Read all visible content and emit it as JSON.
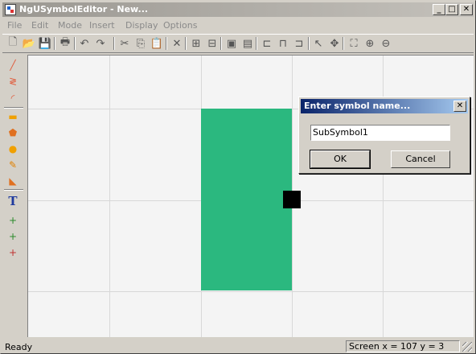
{
  "window": {
    "title": "NgUSymbolEditor - New...",
    "controls": {
      "minimize": "_",
      "maximize": "□",
      "close": "✕"
    }
  },
  "menu": [
    "File",
    "Edit",
    "Mode",
    "Insert",
    "Display",
    "Options"
  ],
  "toolbar": [
    {
      "name": "new-icon",
      "glyph": "🗋"
    },
    {
      "name": "open-icon",
      "glyph": "📂"
    },
    {
      "name": "save-icon",
      "glyph": "💾"
    },
    {
      "name": "print-icon",
      "glyph": "🖶"
    },
    {
      "name": "undo-icon",
      "glyph": "↶"
    },
    {
      "name": "redo-icon",
      "glyph": "↷"
    },
    {
      "name": "cut-icon",
      "glyph": "✂"
    },
    {
      "name": "copy-icon",
      "glyph": "⎘"
    },
    {
      "name": "paste-icon",
      "glyph": "📋"
    },
    {
      "name": "delete-icon",
      "glyph": "✕"
    },
    {
      "name": "group-icon",
      "glyph": "⊞"
    },
    {
      "name": "ungroup-icon",
      "glyph": "⊟"
    },
    {
      "name": "bring-front-icon",
      "glyph": "▣"
    },
    {
      "name": "send-back-icon",
      "glyph": "▤"
    },
    {
      "name": "align-left-icon",
      "glyph": "⊏"
    },
    {
      "name": "align-center-icon",
      "glyph": "⊓"
    },
    {
      "name": "align-right-icon",
      "glyph": "⊐"
    },
    {
      "name": "select-pointer-icon",
      "glyph": "↖"
    },
    {
      "name": "move-pointer-icon",
      "glyph": "✥"
    },
    {
      "name": "zoom-fit-icon",
      "glyph": "⛶"
    },
    {
      "name": "zoom-in-icon",
      "glyph": "⊕"
    },
    {
      "name": "zoom-out-icon",
      "glyph": "⊖"
    }
  ],
  "tools": [
    {
      "name": "line-tool-icon",
      "glyph": "╱",
      "color": "#e05a3a"
    },
    {
      "name": "polyline-tool-icon",
      "glyph": "≷",
      "color": "#e05a3a"
    },
    {
      "name": "arc-tool-icon",
      "glyph": "◜",
      "color": "#e05a3a"
    },
    {
      "name": "rectangle-tool-icon",
      "glyph": "▬",
      "color": "#f0a000"
    },
    {
      "name": "polygon-tool-icon",
      "glyph": "⬟",
      "color": "#e07020"
    },
    {
      "name": "circle-tool-icon",
      "glyph": "●",
      "color": "#f0a000"
    },
    {
      "name": "freehand-tool-icon",
      "glyph": "✎",
      "color": "#e08000"
    },
    {
      "name": "fill-tool-icon",
      "glyph": "◣",
      "color": "#e07020"
    },
    {
      "name": "text-tool-icon",
      "glyph": "T",
      "color": "#1f3a9e"
    },
    {
      "name": "text-anchor-tool-icon",
      "glyph": "+",
      "color": "#2a8a2a"
    },
    {
      "name": "port-tool-icon",
      "glyph": "+",
      "color": "#2a8a2a"
    },
    {
      "name": "connector-tool-icon",
      "glyph": "+",
      "color": "#c03030"
    }
  ],
  "colors": {
    "shape_fill": "#2bb87f",
    "handle": "#000000"
  },
  "dialog": {
    "title": "Enter symbol name...",
    "input_value": "SubSymbol1",
    "ok_label": "OK",
    "cancel_label": "Cancel"
  },
  "status": {
    "left": "Ready",
    "coords": "Screen  x = 107  y = 3"
  }
}
